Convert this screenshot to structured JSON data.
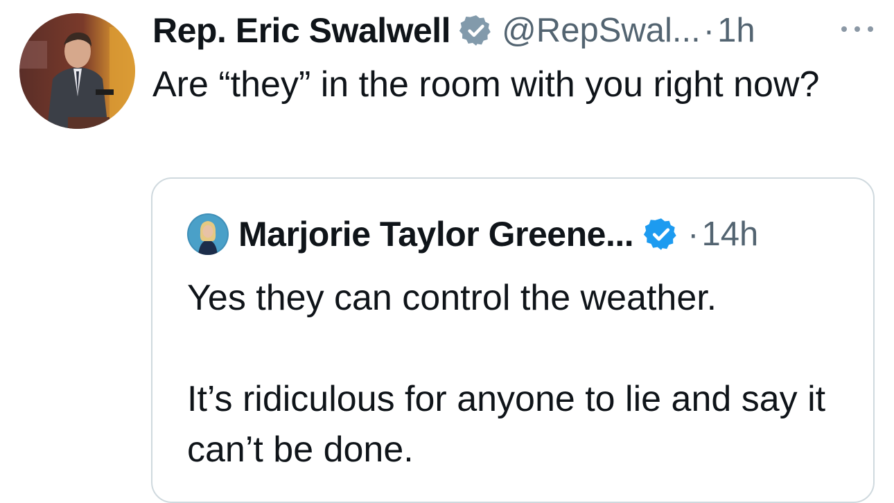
{
  "tweet": {
    "author_name": "Rep. Eric Swalwell",
    "handle": "@RepSwal...",
    "separator": "·",
    "time": "1h",
    "text": "Are “they” in the room with you right now?",
    "verified_badge_color": "#829aab"
  },
  "quoted_tweet": {
    "author_name": "Marjorie Taylor Greene...",
    "separator": "·",
    "time": "14h",
    "text": "Yes they can control the weather.\n\nIt’s ridiculous for anyone to lie and say it can’t be done.",
    "verified_badge_color": "#1d9bf0"
  },
  "icons": {
    "more": "more-options-icon",
    "verified": "verified-badge-icon"
  }
}
